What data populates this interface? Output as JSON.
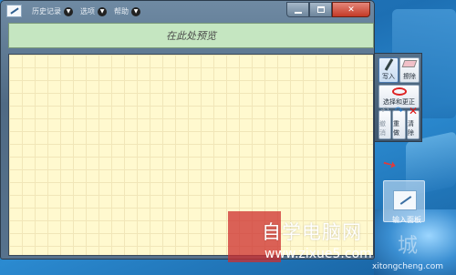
{
  "window": {
    "menus": [
      {
        "label": "历史记录"
      },
      {
        "label": "选项"
      },
      {
        "label": "帮助"
      }
    ],
    "controls": {
      "minimize": "",
      "maximize": "",
      "close": "✕"
    }
  },
  "preview": {
    "text": "在此处预览"
  },
  "tools": {
    "write": "写入",
    "erase": "擦除",
    "select_correct": "选择和更正",
    "undo": "撤消",
    "redo": "重做",
    "clear": "清除"
  },
  "desktop_icon": {
    "label": "输入面板"
  },
  "watermark": {
    "site": "自学电脑网",
    "url": "www.zixue5.com",
    "domain": "xitongcheng.com",
    "logo_glyph": "城"
  },
  "colors": {
    "pad_background": "#fff9cf",
    "preview_background": "#c5e6c1",
    "close_button": "#c43a26",
    "watermark_red": "#cd2d2d"
  }
}
